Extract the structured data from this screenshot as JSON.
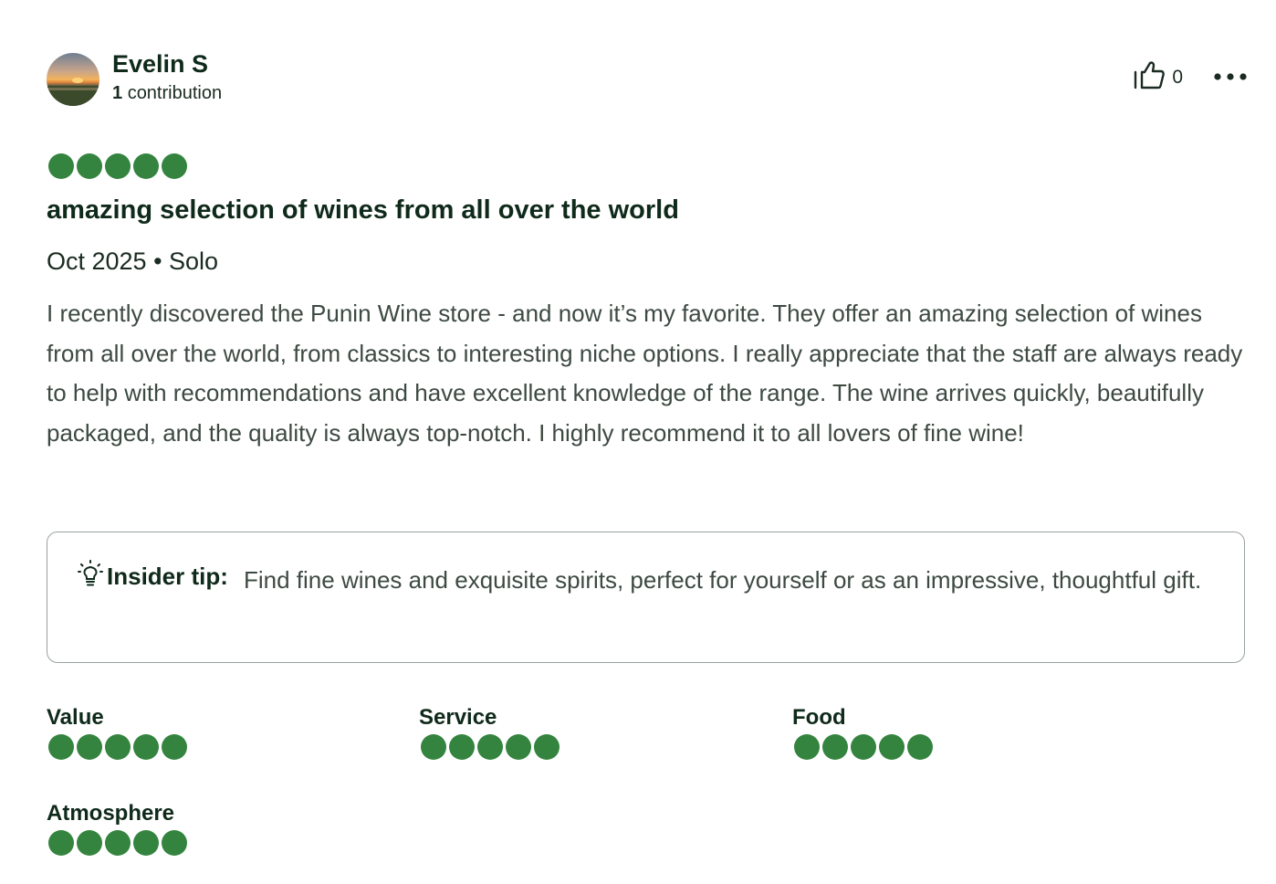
{
  "reviewer": {
    "name": "Evelin S",
    "contributions_count": "1",
    "contributions_label": "contribution"
  },
  "actions": {
    "helpful_count": "0"
  },
  "review": {
    "rating": 5,
    "rating_max": 5,
    "title": "amazing selection of wines from all over the world",
    "date_trip": "Oct 2025 • Solo",
    "body": "I recently discovered the Punin Wine store - and now it’s my favorite. They offer an amazing selection of wines from all over the world, from classics to interesting niche options. I really appreciate that the staff are always ready to help with recommendations and have excellent knowledge of the range. The wine arrives quickly, beautifully packaged, and the quality is always top-notch. I highly recommend it to all lovers of fine wine!"
  },
  "insider_tip": {
    "label": "Insider tip:",
    "text": "Find fine wines and exquisite spirits, perfect for yourself or as an impressive, thoughtful gift."
  },
  "sub_ratings": [
    {
      "label": "Value",
      "rating": 5
    },
    {
      "label": "Service",
      "rating": 5
    },
    {
      "label": "Food",
      "rating": 5
    },
    {
      "label": "Atmosphere",
      "rating": 5
    }
  ],
  "colors": {
    "bubble_fill": "#34843f",
    "text_dark": "#0f2a1a",
    "text_body": "#3d4a42"
  },
  "icons": {
    "like": "thumbs-up-icon",
    "more": "more-options-icon",
    "tip": "lightbulb-icon"
  }
}
